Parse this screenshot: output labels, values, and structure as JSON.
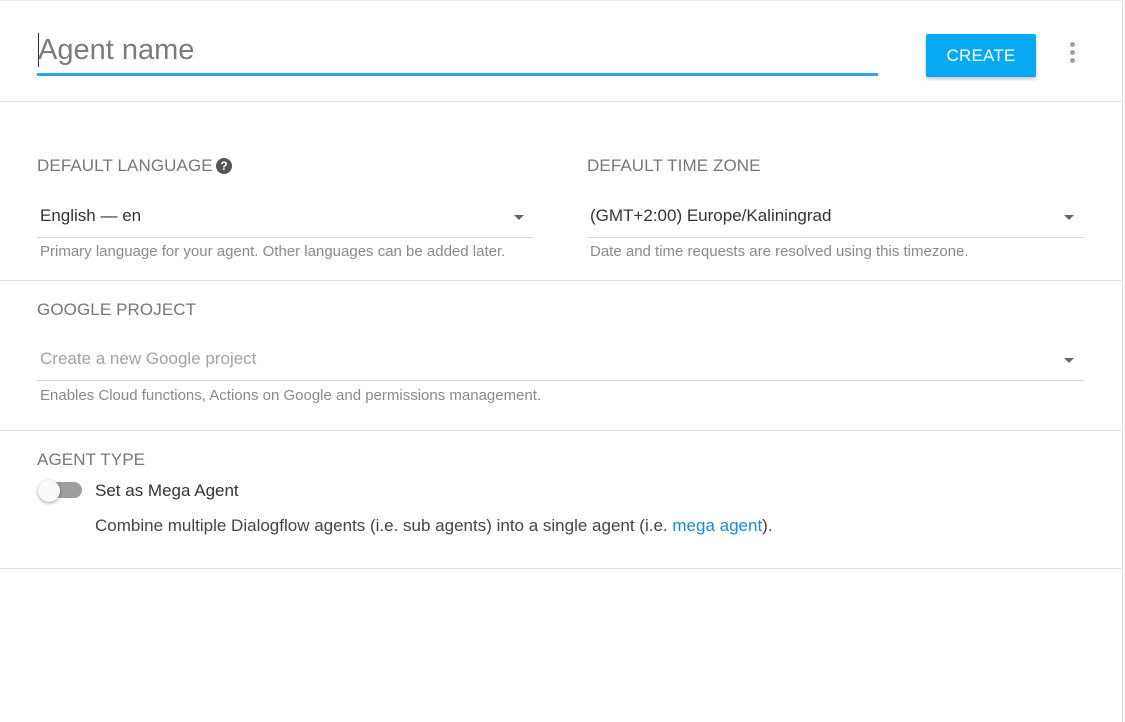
{
  "header": {
    "agent_name_placeholder": "Agent name",
    "create_label": "CREATE"
  },
  "language": {
    "title": "DEFAULT LANGUAGE",
    "value": "English — en",
    "hint": "Primary language for your agent. Other languages can be added later."
  },
  "timezone": {
    "title": "DEFAULT TIME ZONE",
    "value": "(GMT+2:00) Europe/Kaliningrad",
    "hint": "Date and time requests are resolved using this timezone."
  },
  "google_project": {
    "title": "GOOGLE PROJECT",
    "placeholder": "Create a new Google project",
    "hint": "Enables Cloud functions, Actions on Google and permissions management."
  },
  "agent_type": {
    "title": "AGENT TYPE",
    "toggle_label": "Set as Mega Agent",
    "toggle_on": false,
    "desc_before": "Combine multiple Dialogflow agents (i.e. sub agents) into a single agent (i.e. ",
    "desc_link": "mega agent",
    "desc_after": ")."
  },
  "colors": {
    "accent": "#06a9f2",
    "underline": "#2aa6ec",
    "link": "#1e88d2"
  }
}
